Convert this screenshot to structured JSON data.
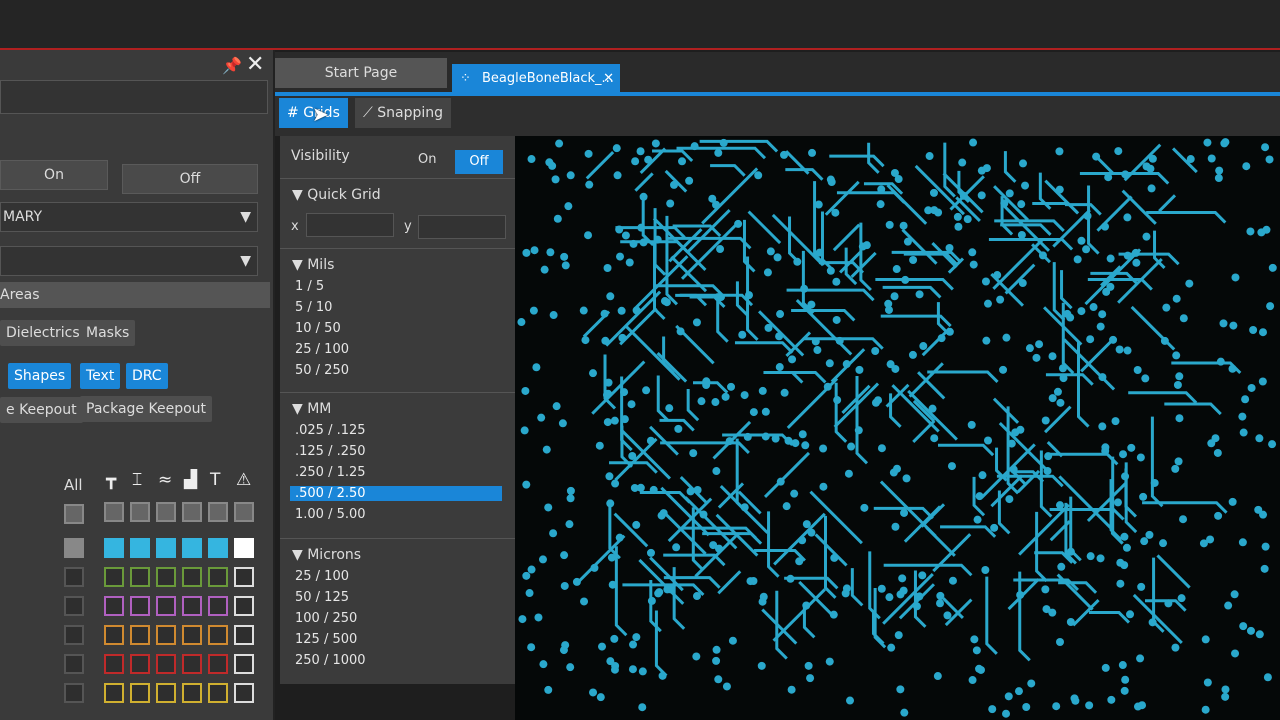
{
  "left_panel": {
    "on_label": "On",
    "off_label": "Off",
    "layer_select": "MARY",
    "second_select": "",
    "areas_header": "Areas",
    "chips_row1": [
      "Dielectrics",
      "Masks"
    ],
    "chips_row2": [
      "Shapes",
      "Text",
      "DRC"
    ],
    "chips_row3": [
      "e Keepout",
      "Package Keepout"
    ],
    "all_label": "All",
    "column_icons": [
      "via-icon",
      "pad-icon",
      "trace-icon",
      "shape-icon",
      "text-icon",
      "drc-icon"
    ],
    "row_colors": [
      "#35b5e0",
      "#6a9a3a",
      "#b060c0",
      "#d08a30",
      "#c02a2a",
      "#d0b030"
    ]
  },
  "tabs": [
    {
      "label": "Start Page"
    },
    {
      "label": "BeagleBoneBlack_..."
    }
  ],
  "toolbar": {
    "grids": "Grids",
    "snapping": "Snapping"
  },
  "grids_panel": {
    "visibility": "Visibility",
    "on": "On",
    "off": "Off",
    "quick_grid": "Quick Grid",
    "x": "x",
    "y": "y",
    "sections": [
      {
        "title": "Mils",
        "items": [
          "1 / 5",
          "5 / 10",
          "10 / 50",
          "25 / 100",
          "50 / 250"
        ]
      },
      {
        "title": "MM",
        "items": [
          ".025 / .125",
          ".125 / .250",
          ".250 / 1.25",
          ".500 / 2.50",
          "1.00 / 5.00"
        ]
      },
      {
        "title": "Microns",
        "items": [
          "25 / 100",
          "50 / 125",
          "100 / 250",
          "125 / 500",
          "250 / 1000"
        ]
      }
    ],
    "selected": ".500 / 2.50"
  },
  "colors": {
    "accent": "#1a86d8",
    "trace": "#2aa8cc"
  }
}
